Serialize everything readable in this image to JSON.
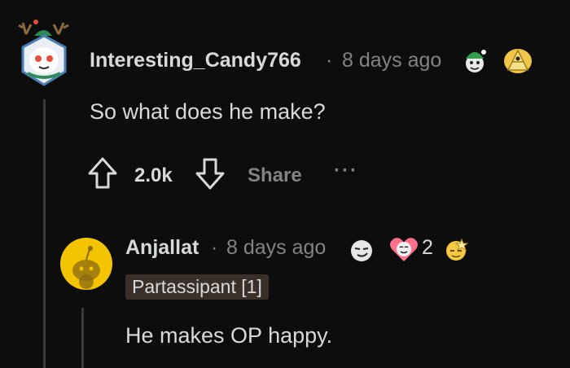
{
  "comment1": {
    "username": "Interesting_Candy766",
    "separator": "·",
    "timestamp": "8 days ago",
    "body": "So what does he make?",
    "vote_count": "2.0k",
    "share_label": "Share",
    "more_label": "···",
    "awards": [
      "elf-hat-award-icon",
      "triangle-award-icon"
    ]
  },
  "comment2": {
    "username": "Anjallat",
    "separator": "·",
    "timestamp": "8 days ago",
    "award_count": "2",
    "flair": "Partassipant [1]",
    "body": "He makes OP happy.",
    "awards": [
      "smirk-award-icon",
      "heart-eyes-award-icon",
      "starry-award-icon"
    ]
  },
  "colors": {
    "background": "#0d0d0d",
    "text": "#d7dadc",
    "muted": "#818384",
    "flair_bg": "#3b2f2a",
    "avatar2_bg": "#f5c400"
  }
}
